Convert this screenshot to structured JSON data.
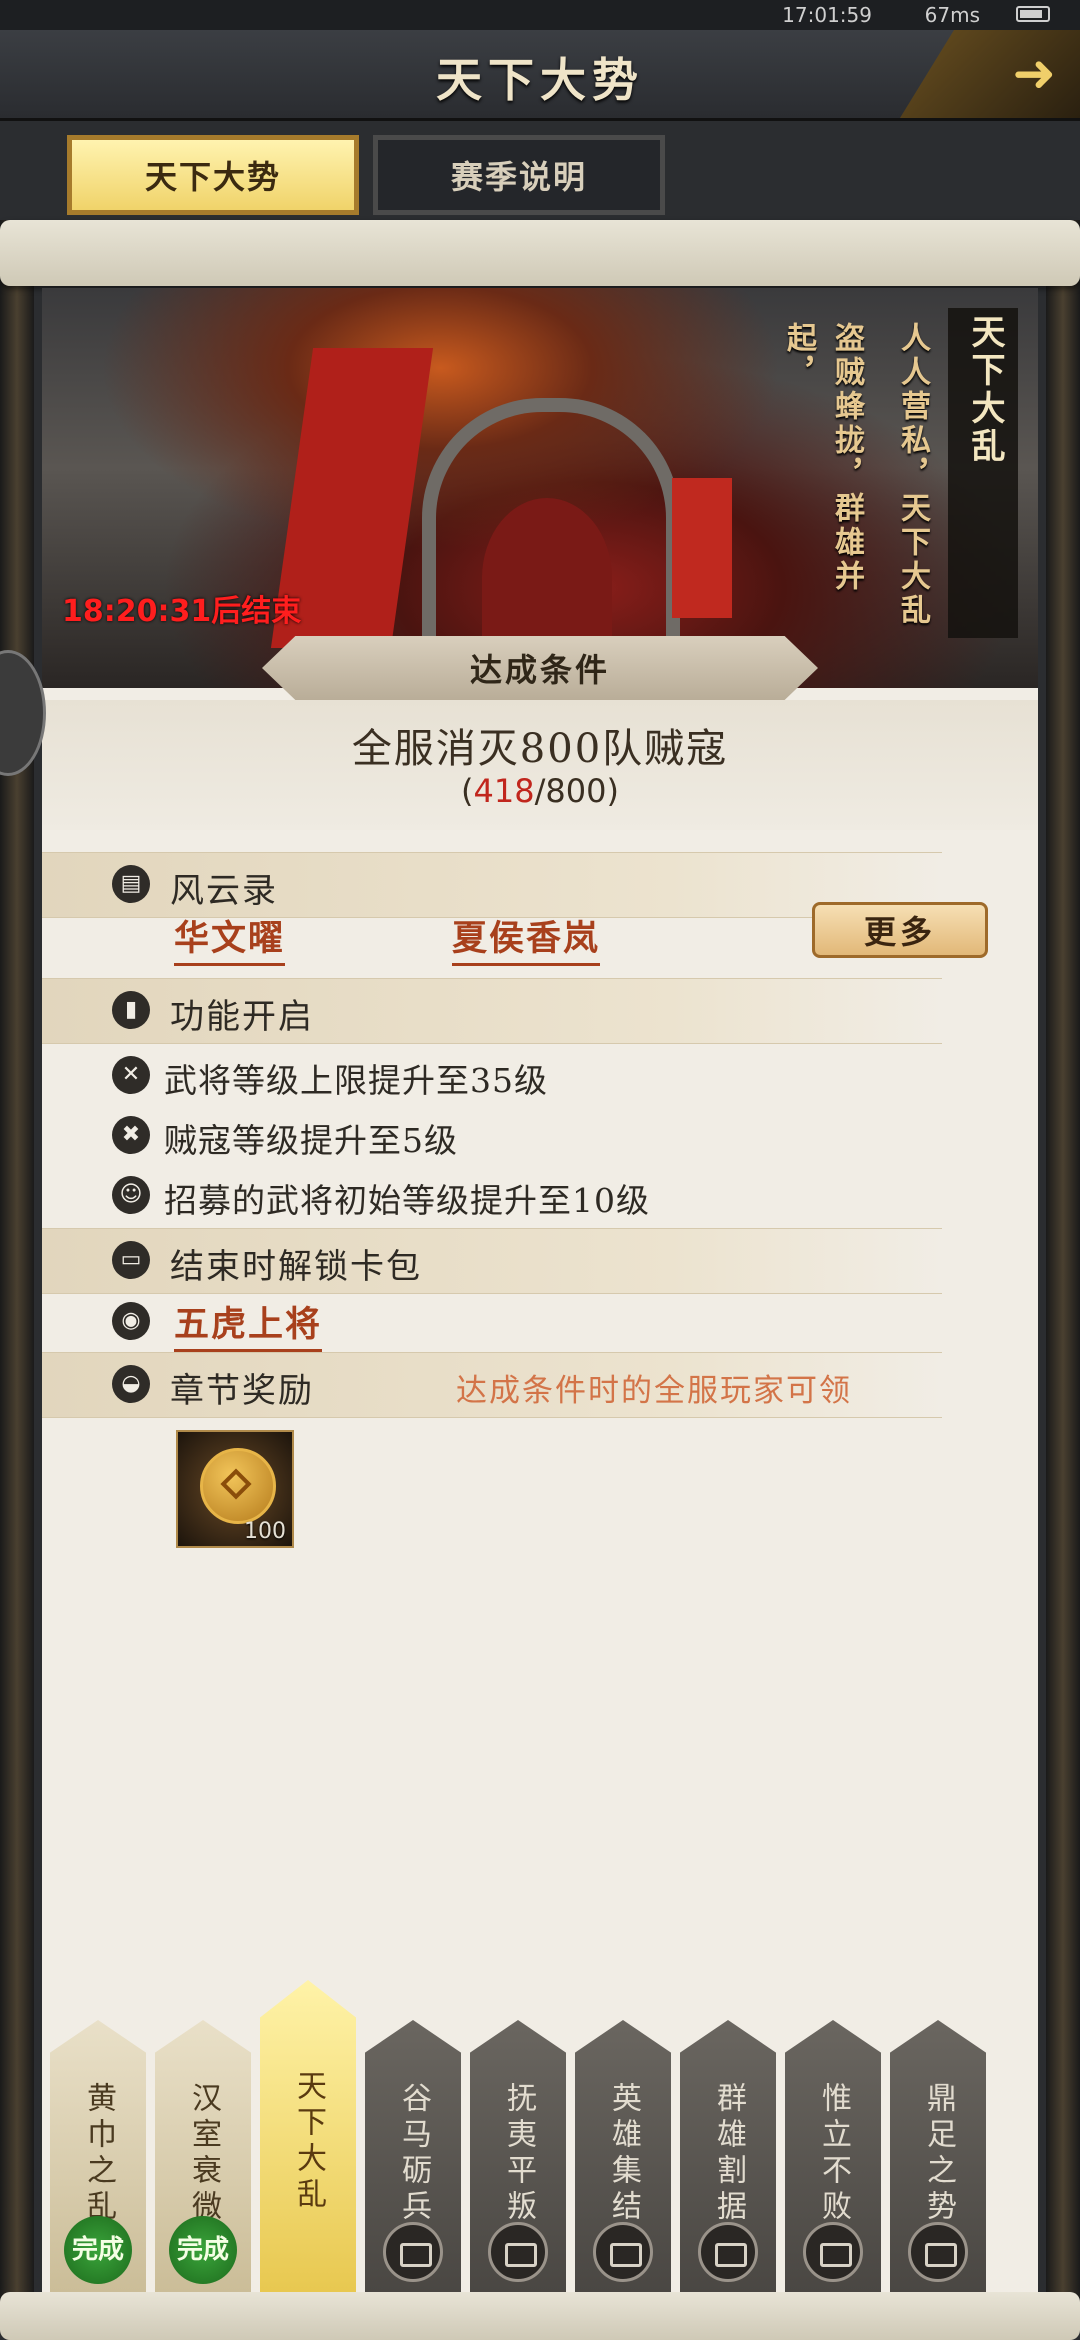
{
  "status_bar": {
    "time": "17:01:59",
    "network": "67ms"
  },
  "header": {
    "title": "天下大势"
  },
  "tabs": [
    {
      "label": "天下大势",
      "active": true
    },
    {
      "label": "赛季说明",
      "active": false
    }
  ],
  "banner": {
    "chapter_title": "天下大乱",
    "poem_lines": [
      "人人营私，天下大乱",
      "盗贼蜂拢，群雄并",
      "起，"
    ],
    "countdown": "18:20:31后结束"
  },
  "condition": {
    "plaque_label": "达成条件",
    "goal_text": "全服消灭800队贼寇",
    "progress_open": "(",
    "progress_current": "418",
    "progress_sep": "/",
    "progress_total": "800",
    "progress_close": ")"
  },
  "sections": {
    "fengyun": {
      "label": "风云录",
      "heroes": [
        "华文曜",
        "夏侯香岚"
      ],
      "more_label": "更多"
    },
    "features": {
      "label": "功能开启",
      "items": [
        "武将等级上限提升至35级",
        "贼寇等级提升至5级",
        "招募的武将初始等级提升至10级"
      ]
    },
    "unlock": {
      "label": "结束时解锁卡包",
      "pack": "五虎上将"
    },
    "reward": {
      "label": "章节奖励",
      "note": "达成条件时的全服玩家可领",
      "item_qty": "100"
    }
  },
  "chapters": [
    {
      "name": "黄巾之乱",
      "state": "done",
      "badge": "完成"
    },
    {
      "name": "汉室衰微",
      "state": "done",
      "badge": "完成"
    },
    {
      "name": "天下大乱",
      "state": "current"
    },
    {
      "name": "谷马砺兵",
      "state": "locked"
    },
    {
      "name": "抚夷平叛",
      "state": "locked"
    },
    {
      "name": "英雄集结",
      "state": "locked"
    },
    {
      "name": "群雄割据",
      "state": "locked"
    },
    {
      "name": "惟立不败",
      "state": "locked"
    },
    {
      "name": "鼎足之势",
      "state": "locked"
    }
  ],
  "colors": {
    "accent": "#a8401c",
    "progress_current": "#c1261d",
    "countdown": "#ff1e1e",
    "note": "#d37448"
  }
}
